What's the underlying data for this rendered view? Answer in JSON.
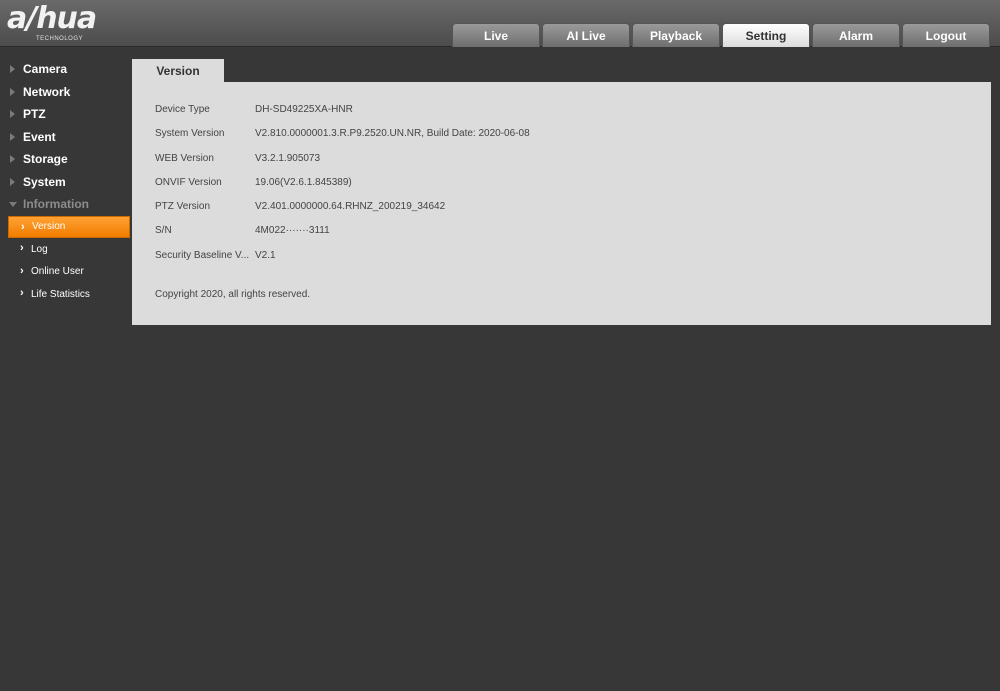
{
  "logo": {
    "word": "a/hua",
    "tagline": "TECHNOLOGY"
  },
  "nav": {
    "tabs": [
      {
        "label": "Live"
      },
      {
        "label": "AI Live"
      },
      {
        "label": "Playback"
      },
      {
        "label": "Setting",
        "active": true
      },
      {
        "label": "Alarm"
      },
      {
        "label": "Logout"
      }
    ]
  },
  "sidebar": {
    "items": [
      {
        "label": "Camera"
      },
      {
        "label": "Network"
      },
      {
        "label": "PTZ"
      },
      {
        "label": "Event"
      },
      {
        "label": "Storage"
      },
      {
        "label": "System"
      },
      {
        "label": "Information",
        "expanded": true
      }
    ],
    "subitems": [
      {
        "label": "Version",
        "active": true
      },
      {
        "label": "Log"
      },
      {
        "label": "Online User"
      },
      {
        "label": "Life Statistics"
      }
    ]
  },
  "content": {
    "tab_label": "Version",
    "rows": [
      {
        "label": "Device Type",
        "value": "DH-SD49225XA-HNR"
      },
      {
        "label": "System Version",
        "value": "V2.810.0000001.3.R.P9.2520.UN.NR, Build Date: 2020-06-08"
      },
      {
        "label": "WEB Version",
        "value": "V3.2.1.905073"
      },
      {
        "label": "ONVIF Version",
        "value": "19.06(V2.6.1.845389)"
      },
      {
        "label": "PTZ Version",
        "value": "V2.401.0000000.64.RHNZ_200219_34642"
      },
      {
        "label": "S/N",
        "value": "4M022·······3111"
      },
      {
        "label": "Security Baseline V...",
        "value": "V2.1"
      }
    ],
    "copyright": "Copyright 2020, all rights reserved."
  }
}
